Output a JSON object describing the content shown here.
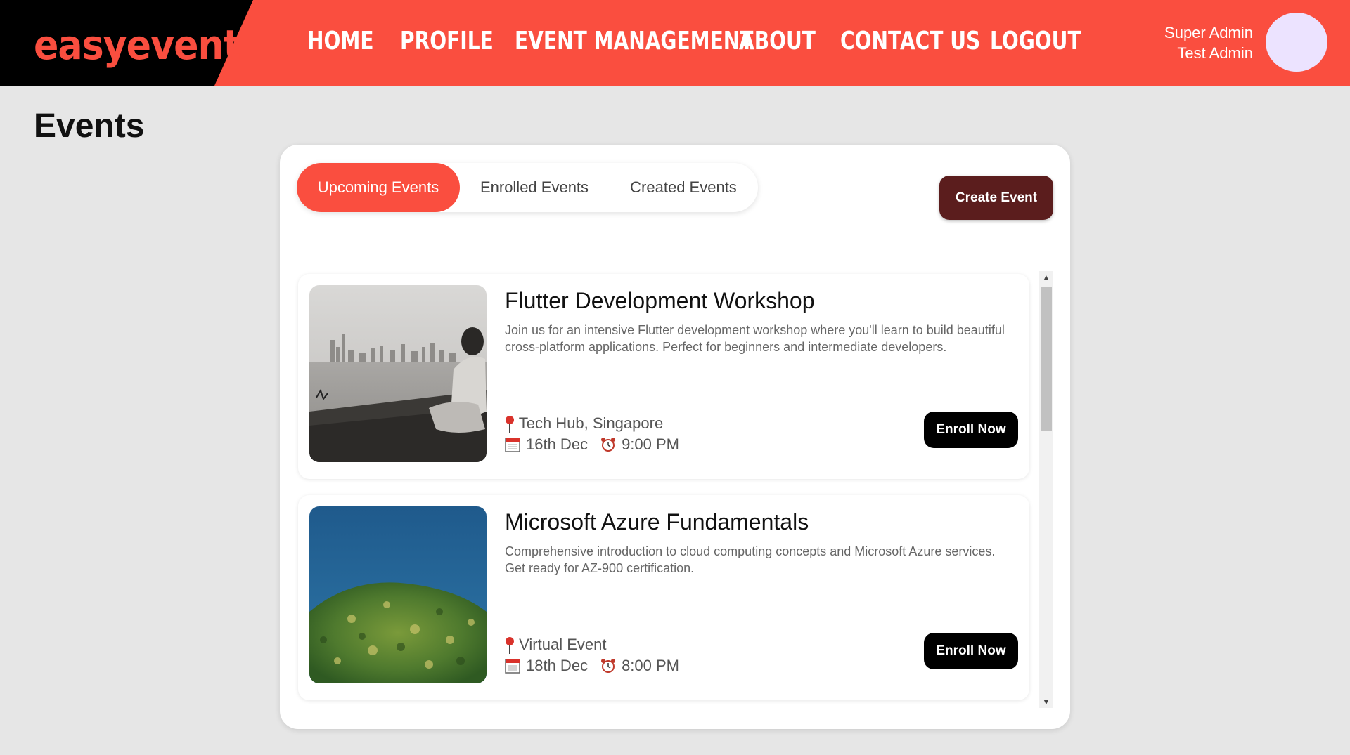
{
  "header": {
    "logo": "easyevent",
    "nav": [
      "HOME",
      "PROFILE",
      "EVENT MANAGEMENT",
      "ABOUT",
      "CONTACT US",
      "LOGOUT"
    ],
    "user_role": "Super Admin",
    "user_name": "Test Admin"
  },
  "page_title": "Events",
  "tabs": {
    "upcoming": "Upcoming Events",
    "enrolled": "Enrolled Events",
    "created": "Created Events"
  },
  "create_button": "Create Event",
  "events": [
    {
      "title": "Flutter Development Workshop",
      "description": "Join us for an intensive Flutter development workshop where you'll learn to build beautiful cross-platform applications. Perfect for beginners and intermediate developers.",
      "location": "Tech Hub, Singapore",
      "date": "16th Dec",
      "time": "9:00 PM",
      "button": "Enroll Now"
    },
    {
      "title": "Microsoft Azure Fundamentals",
      "description": "Comprehensive introduction to cloud computing concepts and Microsoft Azure services. Get ready for AZ-900 certification.",
      "location": "Virtual Event",
      "date": "18th Dec",
      "time": "8:00 PM",
      "button": "Enroll Now"
    }
  ],
  "colors": {
    "accent": "#fa4e3f",
    "create_button": "#5b1d1d",
    "enroll_button": "#000000"
  }
}
